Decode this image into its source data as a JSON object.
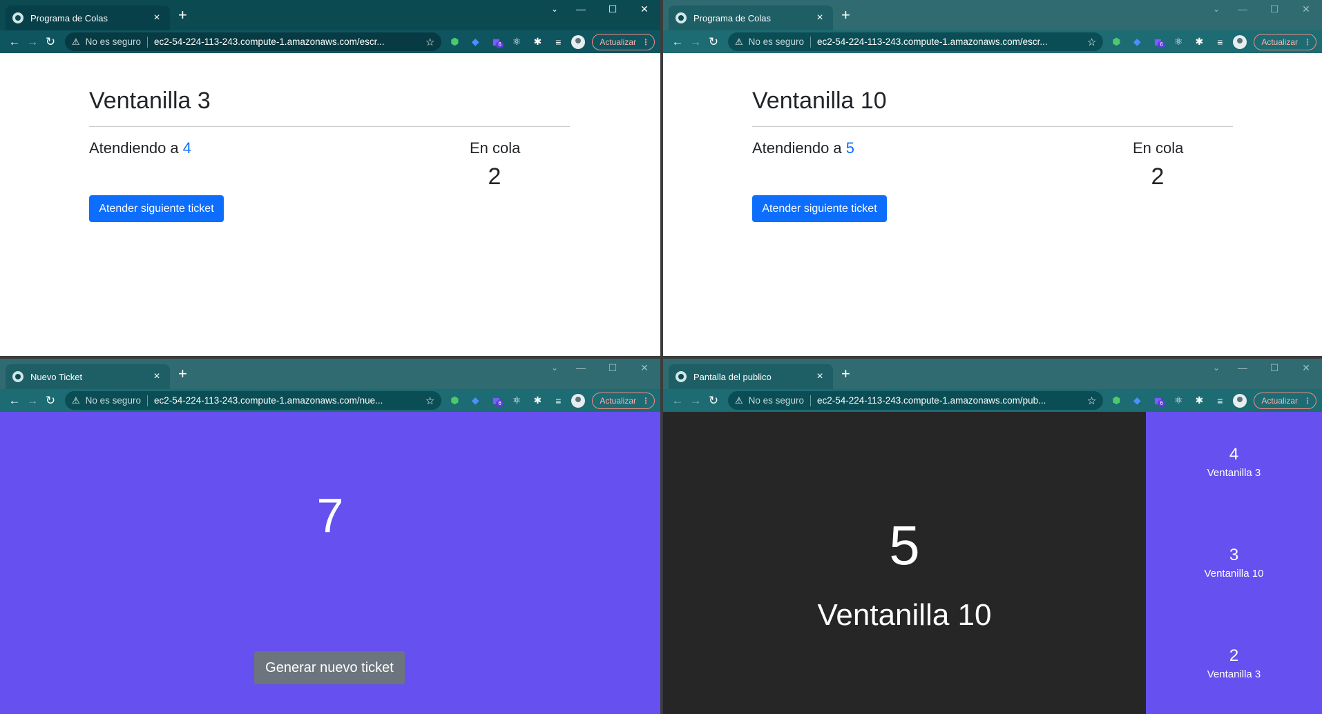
{
  "browser": {
    "not_secure": "No es seguro",
    "update": "Actualizar",
    "extension_badge": "6",
    "new_tab": "+",
    "close_tab": "×",
    "menu_dots": "⋮"
  },
  "windows": [
    {
      "tab_title": "Programa de Colas",
      "url": "ec2-54-224-113-243.compute-1.amazonaws.com/escr...",
      "desk": {
        "heading": "Ventanilla 3",
        "attending_label": "Atendiendo a",
        "attending_number": "4",
        "queue_label": "En cola",
        "queue_count": "2",
        "button": "Atender siguiente ticket"
      }
    },
    {
      "tab_title": "Programa de Colas",
      "url": "ec2-54-224-113-243.compute-1.amazonaws.com/escr...",
      "desk": {
        "heading": "Ventanilla 10",
        "attending_label": "Atendiendo a",
        "attending_number": "5",
        "queue_label": "En cola",
        "queue_count": "2",
        "button": "Atender siguiente ticket"
      }
    },
    {
      "tab_title": "Nuevo Ticket",
      "url": "ec2-54-224-113-243.compute-1.amazonaws.com/nue...",
      "new_ticket": {
        "number": "7",
        "button": "Generar nuevo ticket"
      }
    },
    {
      "tab_title": "Pantalla del publico",
      "url": "ec2-54-224-113-243.compute-1.amazonaws.com/pub...",
      "public": {
        "current_ticket": "5",
        "current_window": "Ventanilla 10",
        "recent": [
          {
            "ticket": "4",
            "window": "Ventanilla 3"
          },
          {
            "ticket": "3",
            "window": "Ventanilla 10"
          },
          {
            "ticket": "2",
            "window": "Ventanilla 3"
          }
        ]
      }
    }
  ],
  "colors": {
    "frame_active": "#0c4a52",
    "frame_inactive": "#2f6b70",
    "primary": "#0d6efd",
    "secondary": "#6c757d",
    "purple": "#6650ef",
    "dark": "#262626"
  }
}
